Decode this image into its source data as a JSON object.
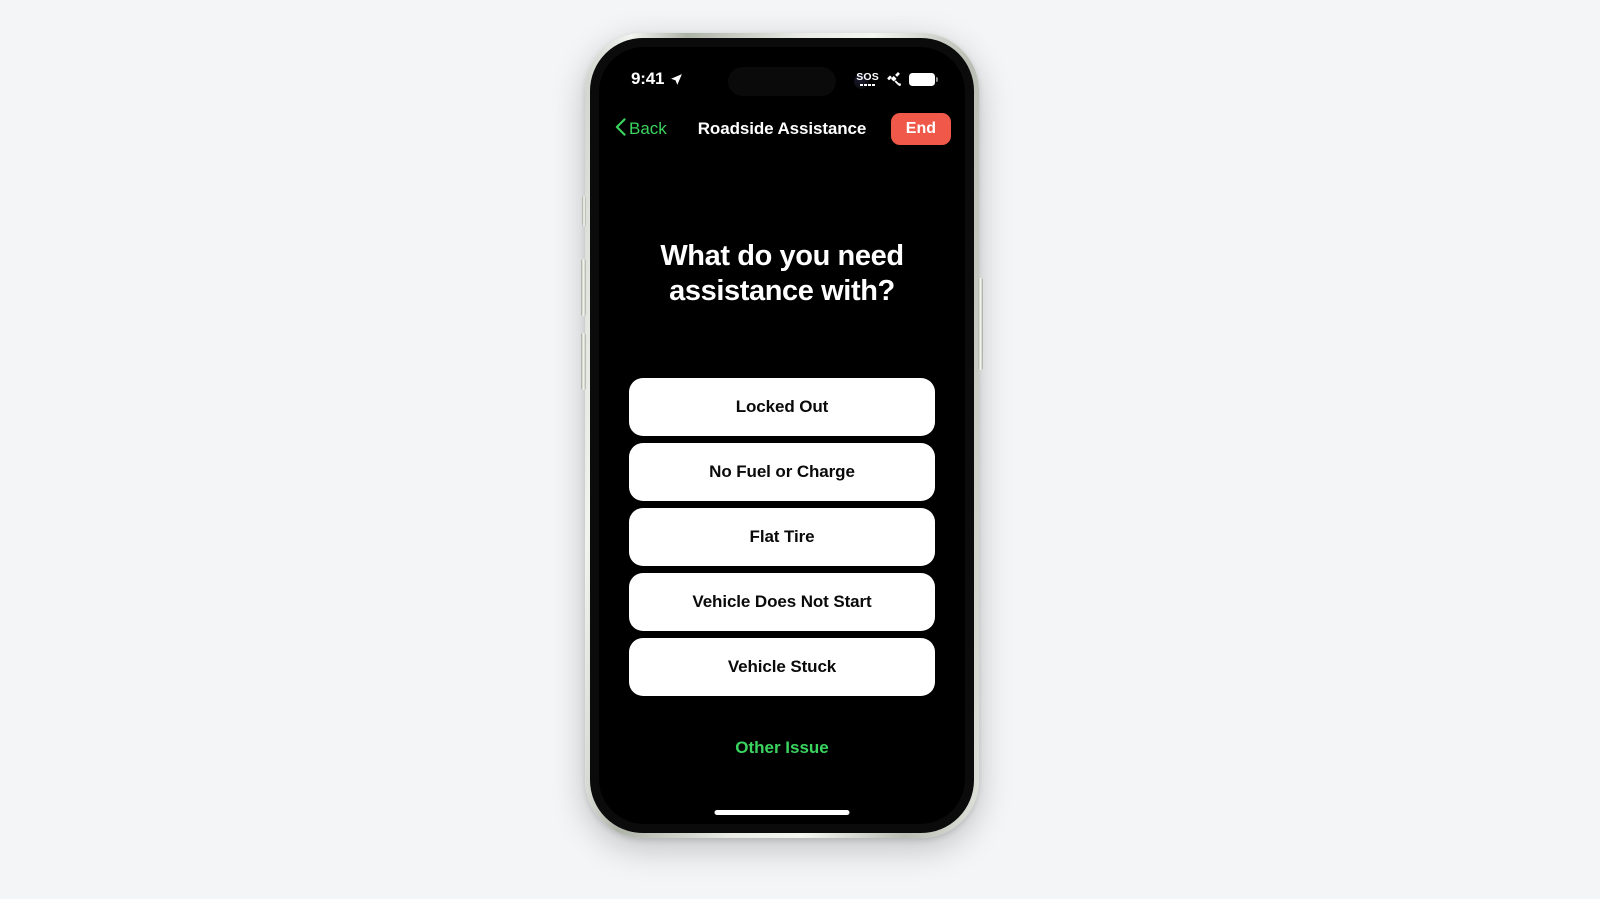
{
  "theme": {
    "page_background": "#f4f5f7",
    "screen_background": "#000000",
    "accent_green": "#3ad45f",
    "end_button_red": "#f0584a",
    "option_background": "#ffffff",
    "option_text": "#0a0a0a"
  },
  "status_bar": {
    "time": "9:41",
    "location_icon": "location-arrow-icon",
    "sos_label": "SOS",
    "satellite_icon": "satellite-icon",
    "battery_icon": "battery-full-icon"
  },
  "nav_bar": {
    "back_label": "Back",
    "back_icon": "chevron-left-icon",
    "title": "Roadside Assistance",
    "end_label": "End"
  },
  "main": {
    "headline": "What do you need assistance with?",
    "options": [
      {
        "label": "Locked Out"
      },
      {
        "label": "No Fuel or Charge"
      },
      {
        "label": "Flat Tire"
      },
      {
        "label": "Vehicle Does Not Start"
      },
      {
        "label": "Vehicle Stuck"
      }
    ],
    "other_issue_label": "Other Issue"
  }
}
